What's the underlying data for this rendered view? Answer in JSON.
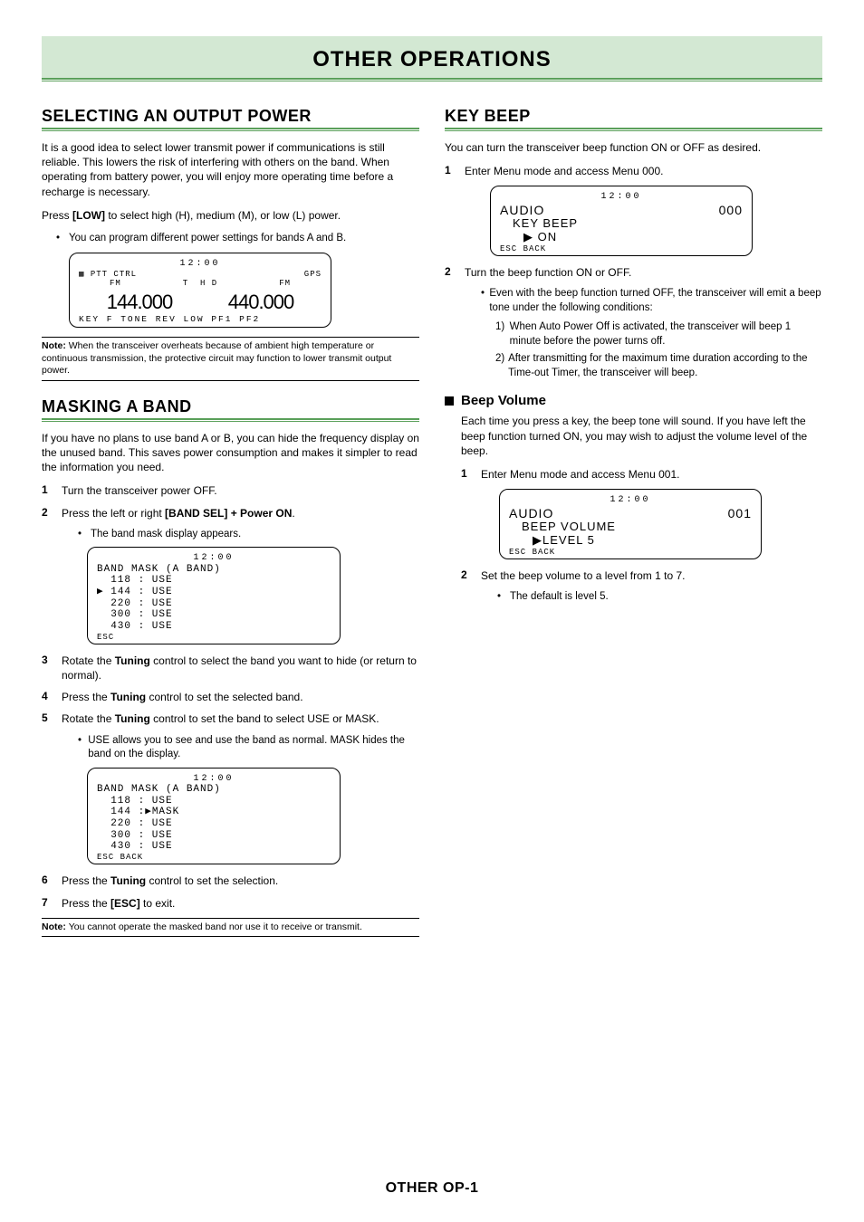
{
  "header": {
    "title": "OTHER OPERATIONS"
  },
  "footer": {
    "label": "OTHER OP-1"
  },
  "left": {
    "sec1": {
      "heading": "SELECTING AN OUTPUT POWER",
      "p1": "It is a good idea to select lower transmit power if communications is still reliable.  This lowers the risk of interfering with others on the band.  When operating from battery power, you will enjoy more operating time before a recharge is necessary.",
      "p2a": "Press ",
      "p2b": "[LOW]",
      "p2c": " to select high (H), medium (M), or low (L) power.",
      "b1": "You can program different power settings for bands A and B.",
      "lcd": {
        "time": "12:00",
        "hdr_left": "PTT CTRL",
        "hdr_fm1": "FM",
        "hdr_t": "T",
        "hdr_hd": "H D",
        "hdr_fm2": "FM",
        "hdr_gps": "GPS",
        "freqA": "144.000",
        "freqB": "440.000",
        "foot": "KEY  F  TONE REV  LOW  PF1  PF2"
      },
      "note": "When the transceiver overheats because of ambient high temperature or continuous transmission, the protective circuit may function to lower transmit output power.",
      "note_label": "Note:  "
    },
    "sec2": {
      "heading": "MASKING A BAND",
      "p1": "If you have no plans to use band A or B, you can hide the frequency display on the unused band.  This saves power consumption and makes it simpler to read the information you need.",
      "s1": "Turn the transceiver power OFF.",
      "s2a": "Press the left or right ",
      "s2b": "[BAND SEL] + Power ON",
      "s2c": ".",
      "s2_b1": "The band mask display appears.",
      "lcd1": {
        "time": "12:00",
        "title": "BAND MASK (A BAND)",
        "r1": "  118 : USE",
        "r2": "▶ 144 : USE",
        "r3": "  220 : USE",
        "r4": "  300 : USE",
        "r5": "  430 : USE",
        "esc": "ESC"
      },
      "s3a": "Rotate the ",
      "s3b": "Tuning",
      "s3c": " control to select the band you want to hide (or return to normal).",
      "s4a": "Press the ",
      "s4b": "Tuning",
      "s4c": " control to set the selected band.",
      "s5a": "Rotate the ",
      "s5b": "Tuning",
      "s5c": " control to set the band to select USE or MASK.",
      "s5_b1": "USE allows you to see and use the band as normal.  MASK hides the band on the display.",
      "lcd2": {
        "time": "12:00",
        "title": "BAND MASK (A BAND)",
        "r1": "  118 : USE",
        "r2": "  144 :▶MASK",
        "r3": "  220 : USE",
        "r4": "  300 : USE",
        "r5": "  430 : USE",
        "esc": "ESC BACK"
      },
      "s6a": "Press the ",
      "s6b": "Tuning",
      "s6c": " control to set the selection.",
      "s7a": "Press the ",
      "s7b": "[ESC]",
      "s7c": " to exit.",
      "note": "You cannot operate the masked band nor use it to receive or transmit.",
      "note_label": "Note:  "
    }
  },
  "right": {
    "sec1": {
      "heading": "KEY BEEP",
      "p1": "You can turn the transceiver beep function ON or OFF as desired.",
      "s1": "Enter Menu mode and access Menu 000.",
      "lcd1": {
        "time": "12:00",
        "cat": "AUDIO",
        "num": "000",
        "name": "KEY BEEP",
        "val": "▶ ON",
        "esc": "ESC BACK"
      },
      "s2": "Turn the beep function ON or OFF.",
      "s2_b1": "Even with the beep function turned OFF, the transceiver will emit a beep tone under the following conditions:",
      "s2_n1": "When Auto Power Off is activated, the transceiver will beep 1 minute before the power turns off.",
      "s2_n2": "After transmitting for the maximum time duration according to the Time-out Timer, the transceiver will beep.",
      "sub_heading": "Beep Volume",
      "sub_p1": "Each time you press a key, the beep tone will sound. If you have left the beep function turned ON, you may wish to adjust the volume level of the beep.",
      "sub_s1": "Enter Menu mode and access Menu 001.",
      "lcd2": {
        "time": "12:00",
        "cat": "AUDIO",
        "num": "001",
        "name": "BEEP VOLUME",
        "val": "▶LEVEL 5",
        "esc": "ESC BACK"
      },
      "sub_s2": "Set the beep volume to a level from 1 to 7.",
      "sub_s2_b1": "The default is level 5."
    }
  }
}
